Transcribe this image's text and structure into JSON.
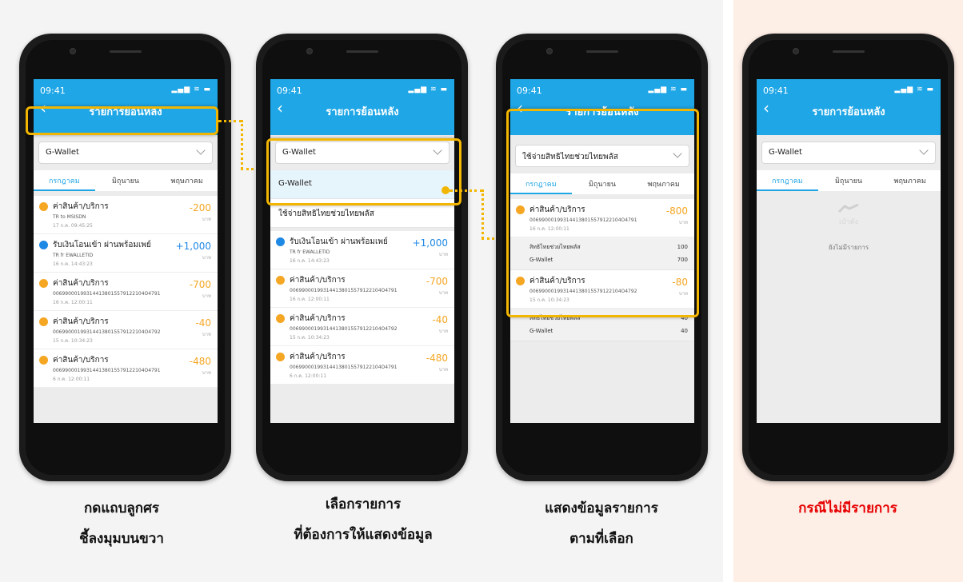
{
  "app": {
    "status_time": "09:41",
    "status_icons": "▂▄▆ ≋ ▬",
    "title": "รายการย้อนหลัง",
    "back_icon": "‹"
  },
  "dropdown": {
    "default_value": "G-Wallet",
    "selected_value_phone3": "ใช้จ่ายสิทธิไทยช่วยไทยพลัส",
    "options": [
      "G-Wallet",
      "ใช้จ่ายสิทธิไทยช่วยไทยพลัส"
    ]
  },
  "tabs": [
    "กรกฎาคม",
    "มิถุนายน",
    "พฤษภาคม"
  ],
  "unit": "บาท",
  "transactions": [
    {
      "title": "ค่าสินค้า/บริการ",
      "ref": "TR to MSISDN",
      "date": "17 ก.ค. 09:45:25",
      "amount": "-200",
      "type": "out"
    },
    {
      "title": "รับเงินโอนเข้า ผ่านพร้อมเพย์",
      "ref": "TR fr EWALLETID",
      "date": "16 ก.ค. 14:43:23",
      "amount": "+1,000",
      "type": "in"
    },
    {
      "title": "ค่าสินค้า/บริการ",
      "ref": "006990001993144138015579122104O4791",
      "date": "16 ก.ค. 12:00:11",
      "amount": "-700",
      "type": "out"
    },
    {
      "title": "ค่าสินค้า/บริการ",
      "ref": "006990001993144138015579122104O4792",
      "date": "15 ก.ค. 10:34:23",
      "amount": "-40",
      "type": "out"
    },
    {
      "title": "ค่าสินค้า/บริการ",
      "ref": "006990001993144138015579122104O4791",
      "date": "6 ก.ค. 12:00:11",
      "amount": "-480",
      "type": "out"
    }
  ],
  "detail_transactions": [
    {
      "title": "ค่าสินค้า/บริการ",
      "ref": "006990001993144138015579122104O4791",
      "date": "16 ก.ค. 12:00:11",
      "amount": "-800",
      "breakdown": [
        {
          "label": "สิทธิไทยช่วยไทยพลัส",
          "value": "100"
        },
        {
          "label": "G-Wallet",
          "value": "700"
        }
      ]
    },
    {
      "title": "ค่าสินค้า/บริการ",
      "ref": "006990001993144138015579122104O4792",
      "date": "15 ก.ค. 10:34:23",
      "amount": "-80",
      "breakdown": [
        {
          "label": "สิทธิไทยช่วยไทยพลัส",
          "value": "40"
        },
        {
          "label": "G-Wallet",
          "value": "40"
        }
      ]
    }
  ],
  "empty_state": {
    "icon_text": "เป๋าตัง",
    "message": "ยังไม่มีรายการ"
  },
  "captions": {
    "step1_line1": "กดแถบลูกศร",
    "step1_line2": "ชี้ลงมุมบนขวา",
    "step2_line1": "เลือกรายการ",
    "step2_line2": "ที่ต้องการให้แสดงข้อมูล",
    "step3_line1": "แสดงข้อมูลรายการ",
    "step3_line2": "ตามที่เลือก",
    "step4": "กรณีไม่มีรายการ"
  },
  "colors": {
    "accent_blue": "#1fa6e6",
    "highlight_yellow": "#f2b600",
    "negative_orange": "#f5a623",
    "caption_red": "#e60000"
  }
}
